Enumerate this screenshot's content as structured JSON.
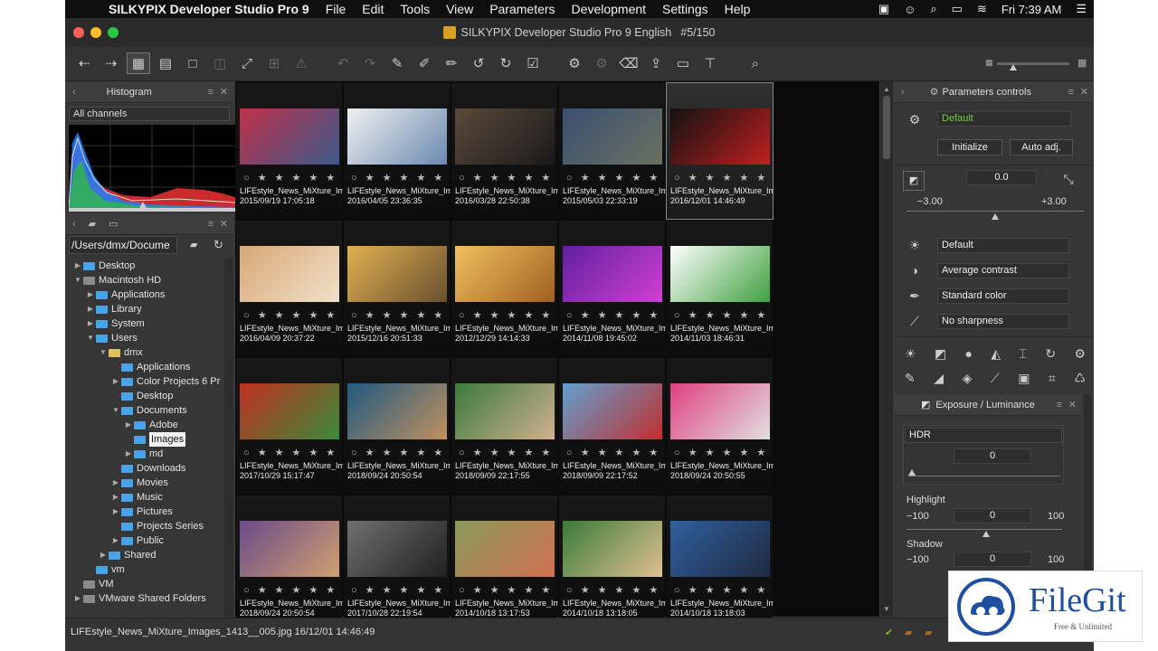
{
  "menubar": {
    "apple": "",
    "app_name": "SILKYPIX Developer Studio Pro 9",
    "items": [
      "File",
      "Edit",
      "Tools",
      "View",
      "Parameters",
      "Development",
      "Settings",
      "Help"
    ],
    "clock": "Fri 7:39 AM"
  },
  "window": {
    "title": "SILKYPIX Developer Studio Pro 9 English",
    "counter": "#5/150"
  },
  "histogram": {
    "title": "Histogram",
    "channel": "All channels"
  },
  "folders": {
    "path": "/Users/dmx/Docume",
    "tree": [
      {
        "label": "Desktop",
        "depth": 0,
        "arrow": "▶",
        "kind": "folder"
      },
      {
        "label": "Macintosh HD",
        "depth": 0,
        "arrow": "▼",
        "kind": "drive"
      },
      {
        "label": "Applications",
        "depth": 1,
        "arrow": "▶",
        "kind": "folder"
      },
      {
        "label": "Library",
        "depth": 1,
        "arrow": "▶",
        "kind": "folder"
      },
      {
        "label": "System",
        "depth": 1,
        "arrow": "▶",
        "kind": "folder"
      },
      {
        "label": "Users",
        "depth": 1,
        "arrow": "▼",
        "kind": "folder"
      },
      {
        "label": "dmx",
        "depth": 2,
        "arrow": "▼",
        "kind": "home"
      },
      {
        "label": "Applications",
        "depth": 3,
        "arrow": "",
        "kind": "folder"
      },
      {
        "label": "Color Projects 6 Pr",
        "depth": 3,
        "arrow": "▶",
        "kind": "folder"
      },
      {
        "label": "Desktop",
        "depth": 3,
        "arrow": "",
        "kind": "folder"
      },
      {
        "label": "Documents",
        "depth": 3,
        "arrow": "▼",
        "kind": "folder"
      },
      {
        "label": "Adobe",
        "depth": 4,
        "arrow": "▶",
        "kind": "folder"
      },
      {
        "label": "Images",
        "depth": 4,
        "arrow": "",
        "kind": "folder",
        "selected": true
      },
      {
        "label": "md",
        "depth": 4,
        "arrow": "▶",
        "kind": "folder"
      },
      {
        "label": "Downloads",
        "depth": 3,
        "arrow": "",
        "kind": "folder"
      },
      {
        "label": "Movies",
        "depth": 3,
        "arrow": "▶",
        "kind": "folder"
      },
      {
        "label": "Music",
        "depth": 3,
        "arrow": "▶",
        "kind": "folder"
      },
      {
        "label": "Pictures",
        "depth": 3,
        "arrow": "▶",
        "kind": "folder"
      },
      {
        "label": "Projects Series",
        "depth": 3,
        "arrow": "",
        "kind": "folder"
      },
      {
        "label": "Public",
        "depth": 3,
        "arrow": "▶",
        "kind": "folder"
      },
      {
        "label": "Shared",
        "depth": 2,
        "arrow": "▶",
        "kind": "folder"
      },
      {
        "label": "vm",
        "depth": 1,
        "arrow": "",
        "kind": "folder"
      },
      {
        "label": "VM",
        "depth": 0,
        "arrow": "",
        "kind": "drive"
      },
      {
        "label": "VMware Shared Folders",
        "depth": 0,
        "arrow": "▶",
        "kind": "drive"
      }
    ]
  },
  "thumbnails": {
    "rating": "○ ★ ★ ★ ★ ★",
    "items": [
      {
        "name": "LIFEstyle_News_MiXture_Images",
        "date": "2015/09/19 17:05:18",
        "colors": [
          "#c0304a",
          "#3a5a8a"
        ]
      },
      {
        "name": "LIFEstyle_News_MiXture_Images",
        "date": "2016/04/05 23:36:35",
        "colors": [
          "#f0f0f0",
          "#6a8ab0"
        ]
      },
      {
        "name": "LIFEstyle_News_MiXture_Images",
        "date": "2016/03/28 22:50:38",
        "colors": [
          "#5a4a3a",
          "#1a1a1a"
        ]
      },
      {
        "name": "LIFEstyle_News_MiXture_Images",
        "date": "2015/05/03 22:33:19",
        "colors": [
          "#3a5070",
          "#6a7060"
        ]
      },
      {
        "name": "LIFEstyle_News_MiXture_Image",
        "date": "2016/12/01 14:46:49",
        "colors": [
          "#111111",
          "#c02020"
        ]
      },
      {
        "name": "LIFEstyle_News_MiXture_Images",
        "date": "2016/04/09 20:37:22",
        "colors": [
          "#d8a878",
          "#f0e0c8"
        ]
      },
      {
        "name": "LIFEstyle_News_MiXture_Images",
        "date": "2015/12/16 20:51:33",
        "colors": [
          "#e0b050",
          "#6a5030"
        ]
      },
      {
        "name": "LIFEstyle_News_MiXture_Images",
        "date": "2012/12/29 14:14:33",
        "colors": [
          "#f0c060",
          "#a06020"
        ]
      },
      {
        "name": "LIFEstyle_News_MiXture_Images",
        "date": "2014/11/08 19:45:02",
        "colors": [
          "#6020a0",
          "#d040d0"
        ]
      },
      {
        "name": "LIFEstyle_News_MiXture_Images",
        "date": "2014/11/03 18:46:31",
        "colors": [
          "#ffffff",
          "#40a040"
        ]
      },
      {
        "name": "LIFEstyle_News_MiXture_Images",
        "date": "2017/10/29 15:17:47",
        "colors": [
          "#c03020",
          "#3a8a3a"
        ]
      },
      {
        "name": "LIFEstyle_News_MiXture_Images",
        "date": "2018/09/24 20:50:54",
        "colors": [
          "#205a80",
          "#c09060"
        ]
      },
      {
        "name": "LIFEstyle_News_MiXture_Images",
        "date": "2018/09/09 22:17:55",
        "colors": [
          "#3a7a3a",
          "#d0b090"
        ]
      },
      {
        "name": "LIFEstyle_News_MiXture_Images",
        "date": "2018/09/09 22:17:52",
        "colors": [
          "#60a0d0",
          "#c03030"
        ]
      },
      {
        "name": "LIFEstyle_News_MiXture_Images",
        "date": "2018/09/24 20:50:55",
        "colors": [
          "#e04080",
          "#e0e0e0"
        ]
      },
      {
        "name": "LIFEstyle_News_MiXture_Images",
        "date": "2018/09/24 20:50:54",
        "colors": [
          "#6a4a8a",
          "#d0a070"
        ]
      },
      {
        "name": "LIFEstyle_News_MiXture_Images",
        "date": "2017/10/28 22:19:54",
        "colors": [
          "#707070",
          "#202020"
        ]
      },
      {
        "name": "LIFEstyle_News_MiXture_Images",
        "date": "2014/10/18 13:17:53",
        "colors": [
          "#8a9a5a",
          "#d07050"
        ]
      },
      {
        "name": "LIFEstyle_News_MiXture_Images",
        "date": "2014/10/18 13:18:05",
        "colors": [
          "#3a7a3a",
          "#e0c090"
        ]
      },
      {
        "name": "LIFEstyle_News_MiXture_Images",
        "date": "2014/10/18 13:18:03",
        "colors": [
          "#3060a0",
          "#202a40"
        ]
      }
    ]
  },
  "params": {
    "title": "Parameters controls",
    "preset": "Default",
    "initialize": "Initialize",
    "auto_adj": "Auto adj.",
    "exposure_value": "0.0",
    "exp_min": "−3.00",
    "exp_max": "+3.00",
    "wb": "Default",
    "tone": "Average contrast",
    "color": "Standard color",
    "sharpness": "No sharpness"
  },
  "exposure_panel": {
    "title": "Exposure / Luminance",
    "hdr_label": "HDR",
    "hdr_value": "0",
    "highlight_label": "Highlight",
    "highlight_min": "−100",
    "highlight_value": "0",
    "highlight_max": "100",
    "shadow_label": "Shadow",
    "shadow_min": "−100",
    "shadow_value": "0",
    "shadow_max": "100"
  },
  "status": {
    "file": "LIFEstyle_News_MiXture_Images_1413__005.jpg 16/12/01 14:46:49"
  },
  "watermark": {
    "brand": "FileGit",
    "tagline": "Free & Unlimited"
  },
  "accent_green": "#6fcf3a"
}
